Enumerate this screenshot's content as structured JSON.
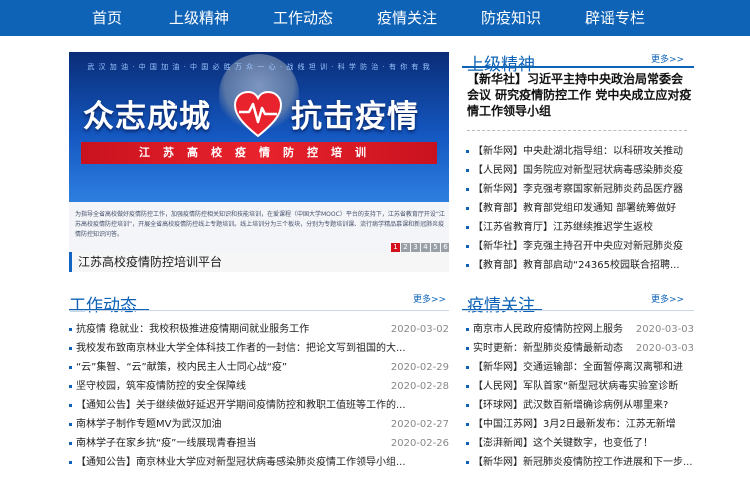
{
  "nav": {
    "items": [
      "首页",
      "上级精神",
      "工作动态",
      "疫情关注",
      "防疫知识",
      "辟谣专栏"
    ]
  },
  "banner": {
    "subtitle": "武 汉 加 油 · 中 国 加 油 · 中 国 必 胜   万 众 一 心 · 战 线 坦 训 · 科 学 防 治 · 有 你 有 我",
    "slogan_left": "众志成城",
    "slogan_right": "抗击疫情",
    "ribbon": "江苏高校疫情防控培训",
    "body_text": "为指导全省高校做好疫情防控工作，加强疫情防控相关知识和技能培训，在爱课程（中国大学MOOC）平台的支持下，江苏省教育厅开设“江苏高校疫情防控培训”，开展全省高校疫情防控线上专题培训。线上培训分为三个板块，分别为专题培训课、流行病学精品慕课和新冠肺炎疫情防控知识问答。",
    "caption": "江苏高校疫情防控培训平台",
    "pages": [
      "1",
      "2",
      "3",
      "4",
      "5",
      "6"
    ]
  },
  "superior": {
    "title": "上级精神",
    "more": "更多>>",
    "headline": "【新华社】习近平主持中央政治局常委会会议 研究疫情防控工作 党中央成立应对疫情工作领导小组",
    "items": [
      "【新华网】中央赴湖北指导组：以科研攻关推动",
      "【人民网】国务院应对新型冠状病毒感染肺炎疫",
      "【新华网】李克强考察国家新冠肺炎药品医疗器",
      "【教育部】教育部党组印发通知 部署统筹做好",
      "【江苏省教育厅】江苏继续推迟学生返校",
      "【新华社】李克强主持召开中央应对新冠肺炎疫",
      "【教育部】教育部启动“24365校园联合招聘..."
    ]
  },
  "work": {
    "title": "工作动态",
    "more": "更多>>",
    "items": [
      {
        "text": "抗疫情 稳就业：我校积极推进疫情期间就业服务工作",
        "date": "2020-03-02"
      },
      {
        "text": "我校发布致南京林业大学全体科技工作者的一封信：把论文写到祖国的大...",
        "date": ""
      },
      {
        "text": "“云”集智、“云”献策，校内民主人士同心战“疫”",
        "date": "2020-02-29"
      },
      {
        "text": "坚守校园，筑牢疫情防控的安全保障线",
        "date": "2020-02-28"
      },
      {
        "text": "【通知公告】关于继续做好延迟开学期间疫情防控和教职工值班等工作的...",
        "date": ""
      },
      {
        "text": "南林学子制作专题MV为武汉加油",
        "date": "2020-02-27"
      },
      {
        "text": "南林学子在家乡抗“疫”一线展现青春担当",
        "date": "2020-02-26"
      },
      {
        "text": "【通知公告】南京林业大学应对新型冠状病毒感染肺炎疫情工作领导小组...",
        "date": ""
      }
    ]
  },
  "epidemic": {
    "title": "疫情关注",
    "more": "更多>>",
    "items": [
      {
        "text": "南京市人民政府疫情防控网上服务",
        "date": "2020-03-03"
      },
      {
        "text": "实时更新：新型肺炎疫情最新动态",
        "date": "2020-03-03"
      },
      {
        "text": "【新华网】交通运输部：全面暂停离汉离鄂和进",
        "date": ""
      },
      {
        "text": "【人民网】军队首家“新型冠状病毒实验室诊断",
        "date": ""
      },
      {
        "text": "【环球网】武汉数百新增确诊病例从哪里来?",
        "date": ""
      },
      {
        "text": "【中国江苏网】3月2日最新发布：江苏无新增",
        "date": ""
      },
      {
        "text": "【澎湃新闻】这个关键数字，也变低了！",
        "date": ""
      },
      {
        "text": "【新华网】新冠肺炎疫情防控工作进展和下一步...",
        "date": ""
      }
    ]
  },
  "colors": {
    "nav_bg": "#0e63b7",
    "accent": "#0e63b7",
    "ribbon": "#e8232d"
  }
}
